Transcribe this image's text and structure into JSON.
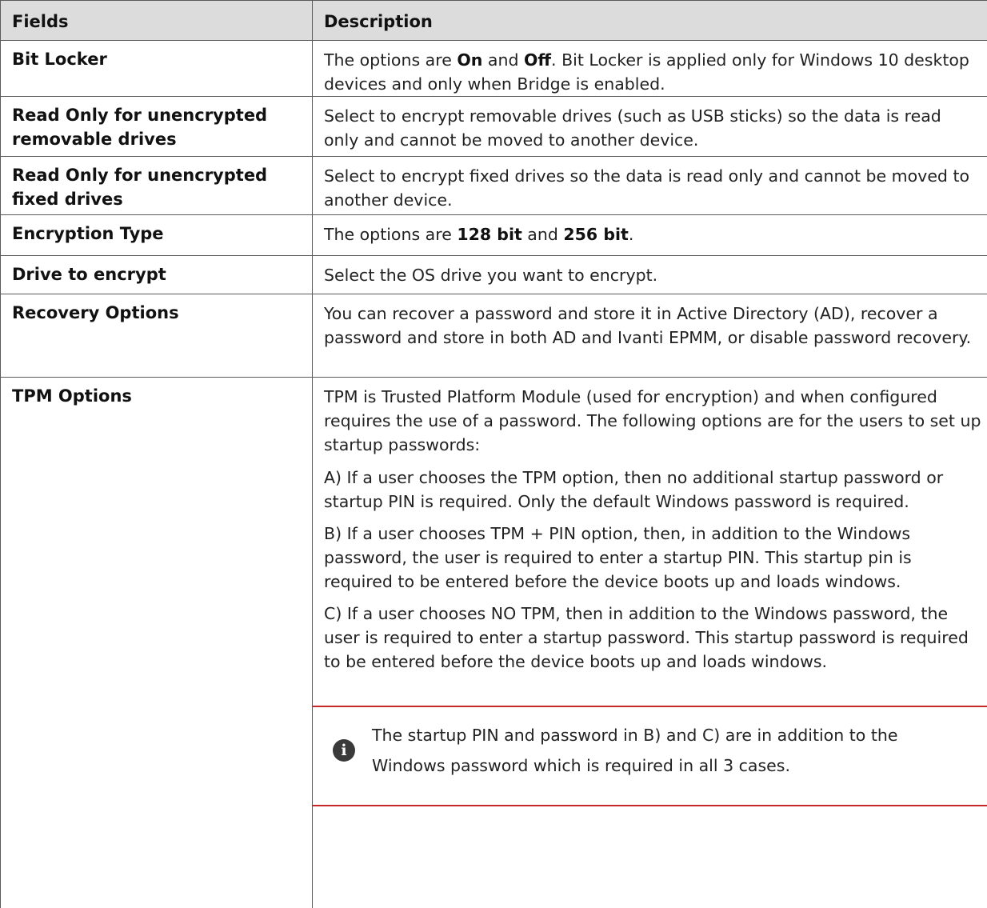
{
  "table": {
    "header": {
      "field": "Fields",
      "description": "Description"
    },
    "rows": {
      "bitlocker": {
        "field": "Bit Locker",
        "d1": "The options are ",
        "d2": "On",
        "d3": " and ",
        "d4": "Off",
        "d5": ". Bit Locker is applied only for Windows 10 desktop devices and only when Bridge is enabled."
      },
      "read_removable": {
        "field": "Read Only for unencrypted removable drives",
        "desc": "Select to encrypt removable drives (such as USB sticks) so the data is read only and cannot be moved to another device."
      },
      "read_fixed": {
        "field": "Read Only for unencrypted fixed drives",
        "desc": "Select to encrypt fixed drives so the data is read only and cannot be moved to another device."
      },
      "encryption_type": {
        "field": "Encryption Type",
        "d1": "The options are ",
        "d2": "128 bit",
        "d3": " and ",
        "d4": "256 bit",
        "d5": "."
      },
      "drive": {
        "field": "Drive to encrypt",
        "desc": "Select the OS drive you want to encrypt."
      },
      "recovery": {
        "field": "Recovery Options",
        "desc": "You can recover a password and store it in Active Directory (AD), recover a password and store in both AD and Ivanti EPMM, or disable password recovery."
      },
      "tpm": {
        "field": "TPM Options",
        "p1": "TPM is Trusted Platform Module (used for encryption) and when configured requires the use of a password. The following options are for the users to set up startup passwords:",
        "p2": "A) If a user chooses the TPM option, then no additional startup password or startup PIN is required. Only the default Windows password is required.",
        "p3": "B) If a user chooses TPM + PIN option, then, in addition to the Windows password, the user is required to enter a startup PIN. This startup pin is required to be entered before the device boots up and loads windows.",
        "p4": "C) If a user chooses NO TPM, then in addition to the Windows password, the user is required to enter a startup password. This startup password is required to be entered before the device boots up and loads windows.",
        "note": {
          "icon": "info-icon",
          "text": "The startup PIN and password in B) and C) are in addition to the Windows password which is required in all 3 cases."
        }
      }
    }
  }
}
